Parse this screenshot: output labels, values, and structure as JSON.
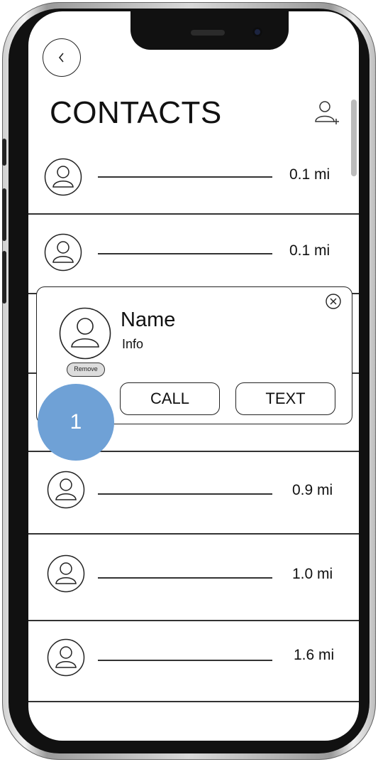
{
  "header": {
    "title": "CONTACTS"
  },
  "contacts": [
    {
      "distance": "0.1 mi"
    },
    {
      "distance": "0.1 mi"
    },
    {
      "distance": "0.9 mi"
    },
    {
      "distance": "1.0 mi"
    },
    {
      "distance": "1.6 mi"
    }
  ],
  "popup": {
    "name": "Name",
    "info": "Info",
    "remove_label": "Remove",
    "call_label": "CALL",
    "text_label": "TEXT"
  },
  "annotation": {
    "number": "1",
    "color": "#6fa1d6"
  },
  "icons": {
    "back": "chevron-left-icon",
    "add_contact": "add-user-icon",
    "avatar": "user-icon",
    "close": "close-icon"
  }
}
